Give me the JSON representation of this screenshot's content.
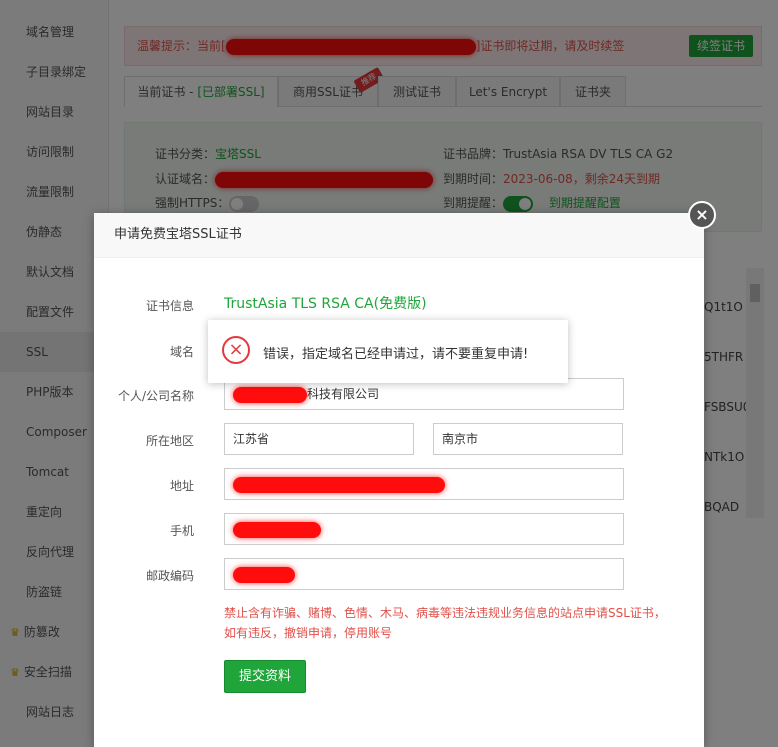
{
  "sidebar": {
    "items": [
      {
        "label": "域名管理",
        "premium": false,
        "active": false
      },
      {
        "label": "子目录绑定",
        "premium": false,
        "active": false
      },
      {
        "label": "网站目录",
        "premium": false,
        "active": false
      },
      {
        "label": "访问限制",
        "premium": false,
        "active": false
      },
      {
        "label": "流量限制",
        "premium": false,
        "active": false
      },
      {
        "label": "伪静态",
        "premium": false,
        "active": false
      },
      {
        "label": "默认文档",
        "premium": false,
        "active": false
      },
      {
        "label": "配置文件",
        "premium": false,
        "active": false
      },
      {
        "label": "SSL",
        "premium": false,
        "active": true
      },
      {
        "label": "PHP版本",
        "premium": false,
        "active": false
      },
      {
        "label": "Composer",
        "premium": false,
        "active": false
      },
      {
        "label": "Tomcat",
        "premium": false,
        "active": false
      },
      {
        "label": "重定向",
        "premium": false,
        "active": false
      },
      {
        "label": "反向代理",
        "premium": false,
        "active": false
      },
      {
        "label": "防盗链",
        "premium": false,
        "active": false
      },
      {
        "label": "防篡改",
        "premium": true,
        "active": false
      },
      {
        "label": "安全扫描",
        "premium": true,
        "active": false
      },
      {
        "label": "网站日志",
        "premium": false,
        "active": false
      }
    ]
  },
  "notice": {
    "prefix": "温馨提示：当前[",
    "suffix": "]证书即将过期，请及时续签",
    "renew_label": "续签证书"
  },
  "tabs": [
    {
      "label": "当前证书 - ",
      "status": "[已部署SSL]"
    },
    {
      "label": "商用SSL证书",
      "badge": "推荐"
    },
    {
      "label": "测试证书"
    },
    {
      "label": "Let's Encrypt"
    },
    {
      "label": "证书夹"
    }
  ],
  "cert": {
    "category_label": "证书分类：",
    "category_value": "宝塔SSL",
    "brand_label": "证书品牌：",
    "brand_value": "TrustAsia RSA DV TLS CA G2",
    "domain_label": "认证域名：",
    "expire_label": "到期时间：",
    "expire_value": "2023-06-08，剩余24天到期",
    "https_label": "强制HTTPS：",
    "remind_label": "到期提醒：",
    "remind_link": "到期提醒配置"
  },
  "bg_list": [
    "Q1t1O",
    "5THFR",
    "FSBSU0",
    "NTk1O",
    "BQAD"
  ],
  "modal": {
    "title": "申请免费宝塔SSL证书",
    "close_icon": "×",
    "fields": {
      "cert_info_label": "证书信息",
      "cert_info_value": "TrustAsia TLS RSA CA(免费版)",
      "domain_label": "域名",
      "company_label": "个人/公司名称",
      "company_value": "科技有限公司",
      "region_label": "所在地区",
      "province_value": "江苏省",
      "city_value": "南京市",
      "address_label": "地址",
      "phone_label": "手机",
      "postcode_label": "邮政编码"
    },
    "warning_line1": "禁止含有诈骗、赌博、色情、木马、病毒等违法违规业务信息的站点申请SSL证书，",
    "warning_line2": "如有违反，撤销申请，停用账号",
    "submit_label": "提交资料"
  },
  "toast": {
    "icon": "×",
    "message": "错误，指定域名已经申请过，请不要重复申请!"
  },
  "colors": {
    "accent_green": "#20a53a",
    "error_red": "#e4393c",
    "redaction": "#ff0d0d"
  }
}
